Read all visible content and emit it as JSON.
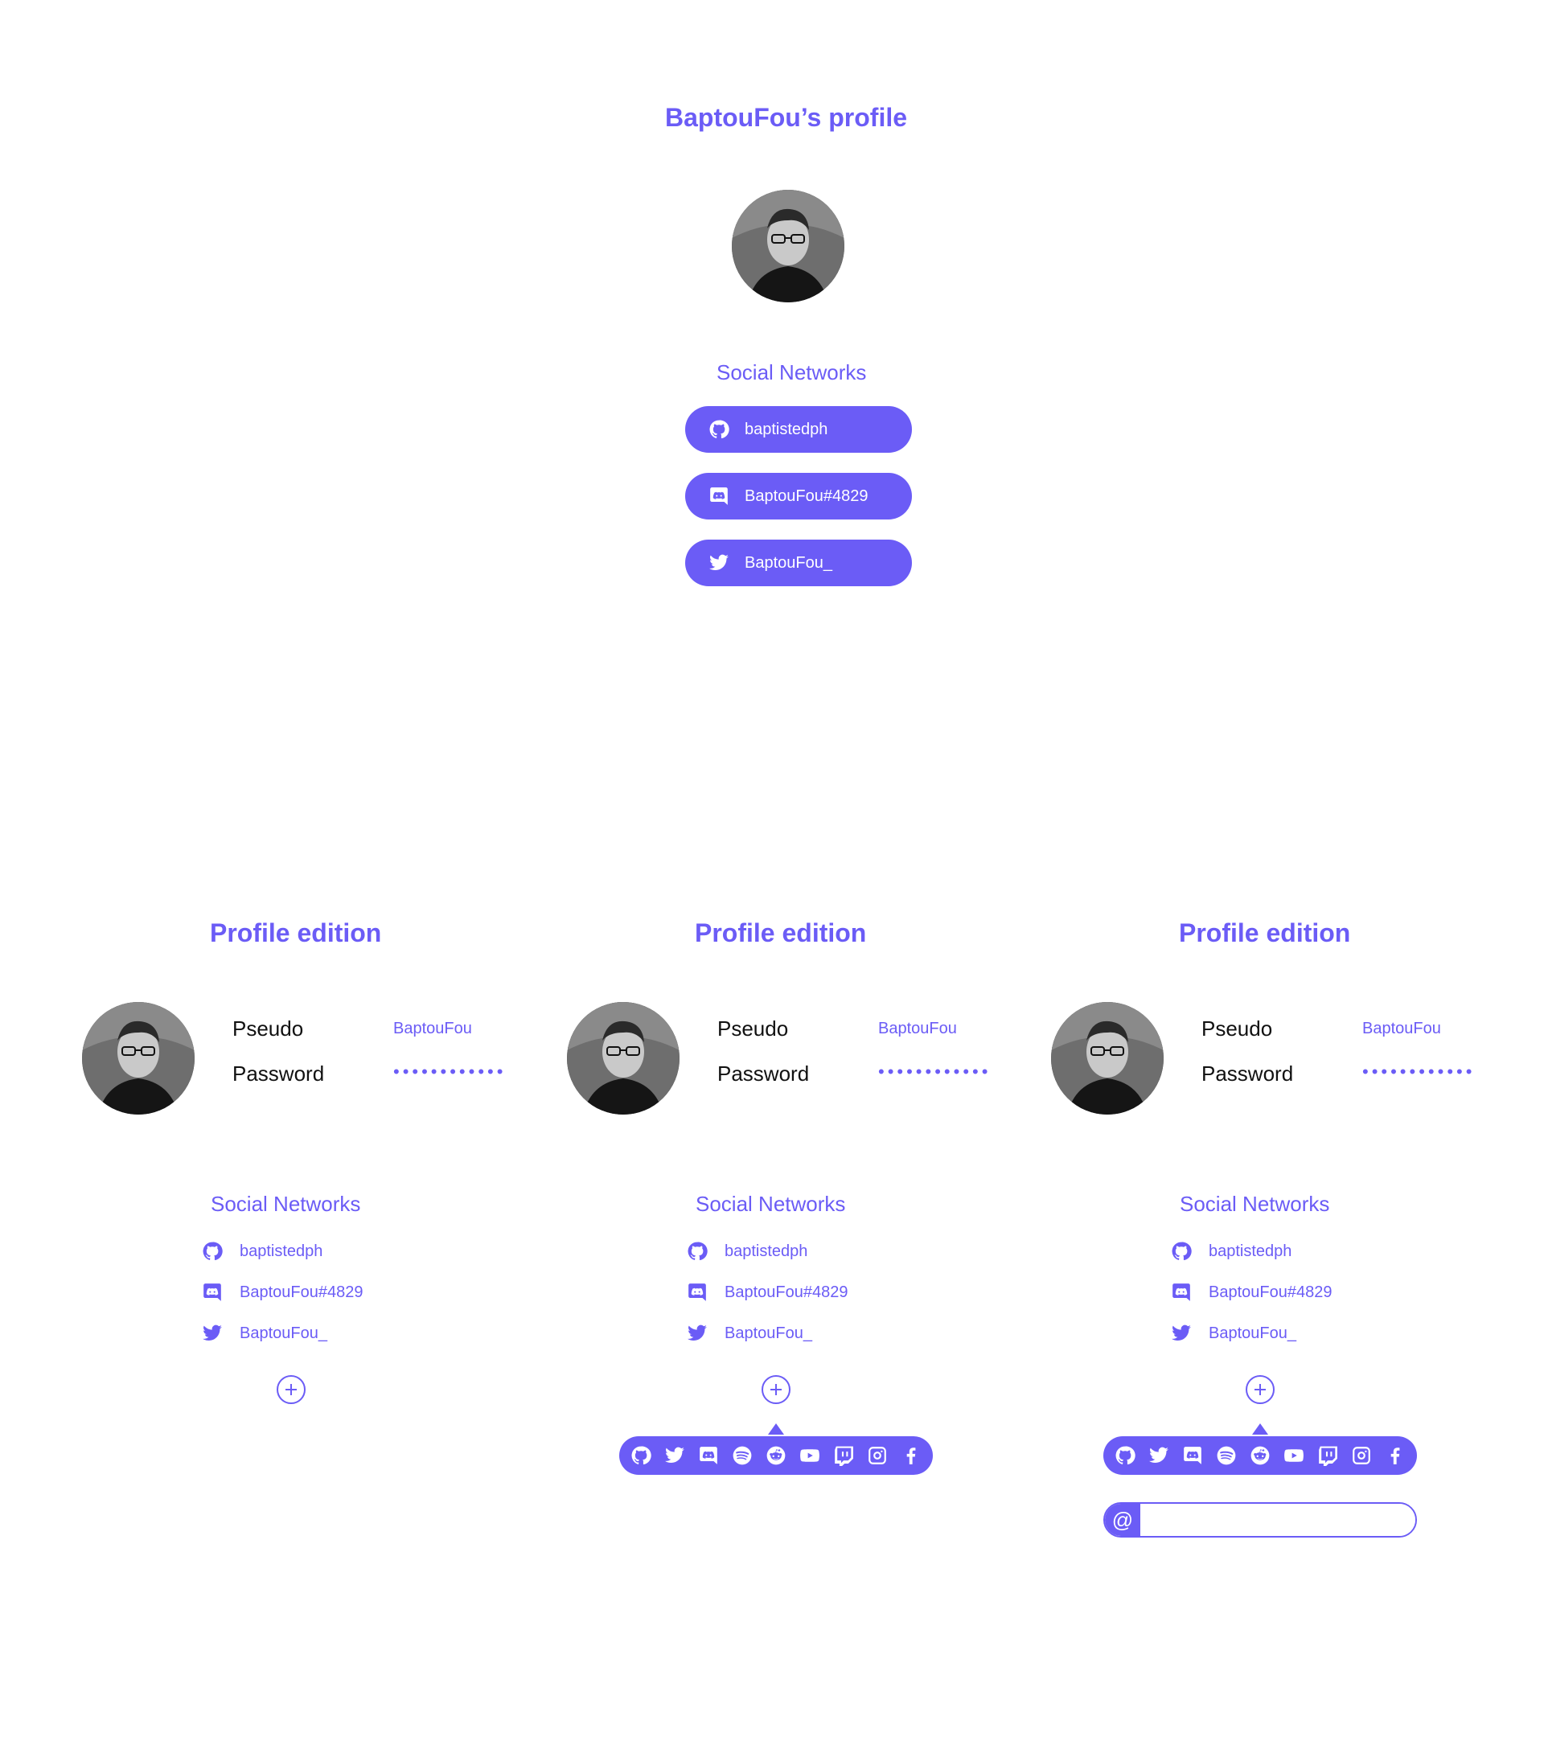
{
  "colors": {
    "accent": "#6b5cf6",
    "text_dark": "#111111",
    "background": "#ffffff"
  },
  "profile": {
    "title": "BaptouFou’s profile",
    "social_title": "Social Networks",
    "networks": [
      {
        "icon": "github-icon",
        "label": "baptistedph"
      },
      {
        "icon": "discord-icon",
        "label": "BaptouFou#4829"
      },
      {
        "icon": "twitter-icon",
        "label": "BaptouFou_"
      }
    ]
  },
  "editions": [
    {
      "title": "Profile edition",
      "pseudo_label": "Pseudo",
      "pseudo_value": "BaptouFou",
      "password_label": "Password",
      "password_value": "••••••••••••",
      "social_title": "Social Networks",
      "networks": [
        {
          "icon": "github-icon",
          "label": "baptistedph"
        },
        {
          "icon": "discord-icon",
          "label": "BaptouFou#4829"
        },
        {
          "icon": "twitter-icon",
          "label": "BaptouFou_"
        }
      ],
      "show_picker": false,
      "show_input": false
    },
    {
      "title": "Profile edition",
      "pseudo_label": "Pseudo",
      "pseudo_value": "BaptouFou",
      "password_label": "Password",
      "password_value": "••••••••••••",
      "social_title": "Social Networks",
      "networks": [
        {
          "icon": "github-icon",
          "label": "baptistedph"
        },
        {
          "icon": "discord-icon",
          "label": "BaptouFou#4829"
        },
        {
          "icon": "twitter-icon",
          "label": "BaptouFou_"
        }
      ],
      "show_picker": true,
      "show_input": false
    },
    {
      "title": "Profile edition",
      "pseudo_label": "Pseudo",
      "pseudo_value": "BaptouFou",
      "password_label": "Password",
      "password_value": "••••••••••••",
      "social_title": "Social Networks",
      "networks": [
        {
          "icon": "github-icon",
          "label": "baptistedph"
        },
        {
          "icon": "discord-icon",
          "label": "BaptouFou#4829"
        },
        {
          "icon": "twitter-icon",
          "label": "BaptouFou_"
        }
      ],
      "show_picker": true,
      "show_input": true
    }
  ],
  "picker_icons": [
    "github-icon",
    "twitter-icon",
    "discord-icon",
    "spotify-icon",
    "reddit-icon",
    "youtube-icon",
    "twitch-icon",
    "instagram-icon",
    "facebook-icon"
  ],
  "input": {
    "prefix": "@",
    "value": ""
  }
}
